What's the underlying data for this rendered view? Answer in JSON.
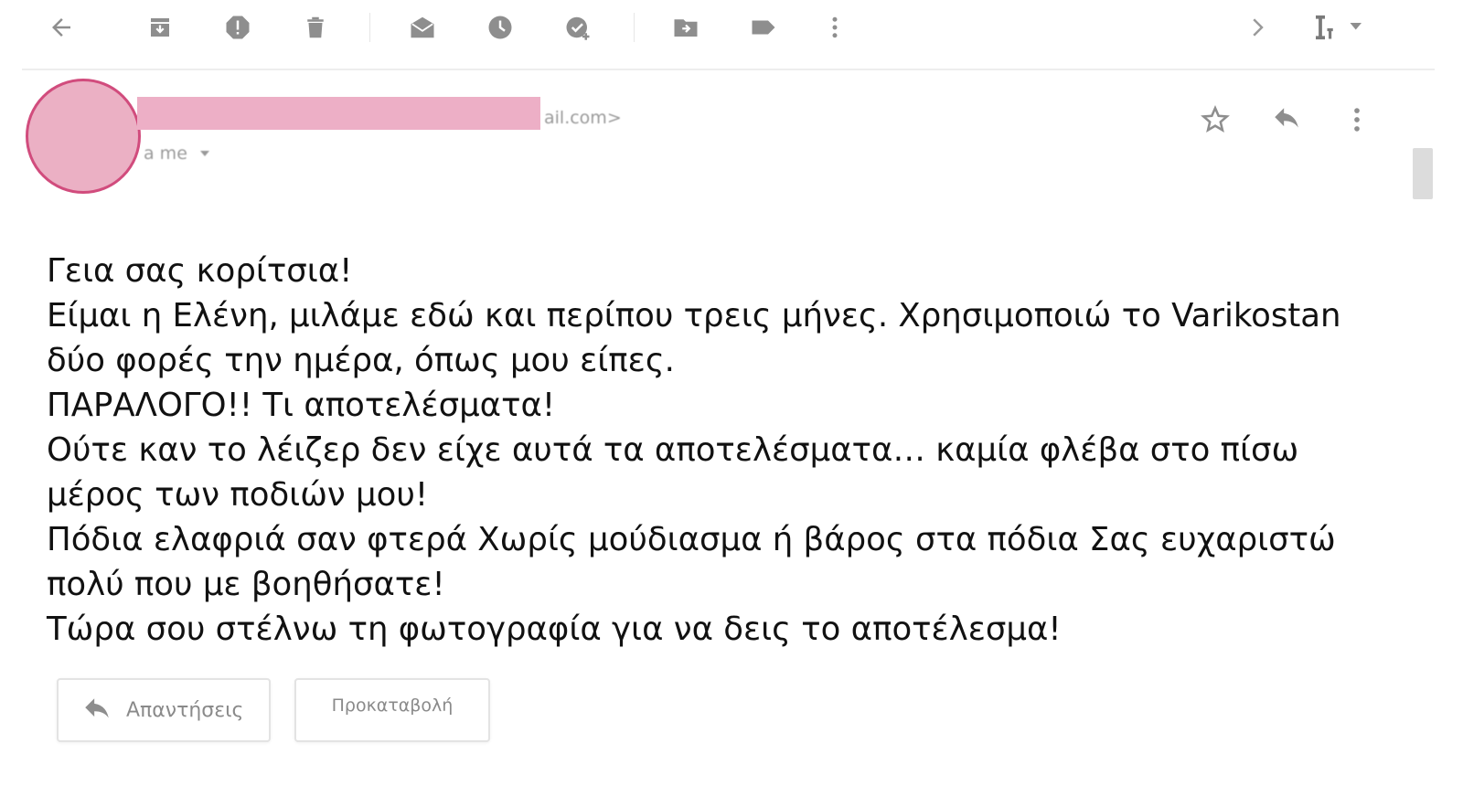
{
  "toolbar": {
    "icons": [
      "back-arrow-icon",
      "archive-icon",
      "report-spam-icon",
      "delete-icon",
      "mark-unread-icon",
      "snooze-icon",
      "add-to-tasks-icon",
      "move-to-icon",
      "labels-icon",
      "more-vert-icon",
      "next-icon",
      "input-tools-icon"
    ]
  },
  "header": {
    "sender_suffix": "ail.com>",
    "recipient": "a me"
  },
  "message": {
    "lines": [
      "Γεια σας κορίτσια!",
      "Είμαι η Ελένη, μιλάμε εδώ και περίπου τρεις μήνες. Χρησιμοποιώ το Varikostan δύο φορές την ημέρα, όπως μου είπες.",
      "ΠΑΡΑΛΟΓΟ!! Τι αποτελέσματα!",
      "Ούτε καν το λέιζερ δεν είχε αυτά τα αποτελέσματα… καμία φλέβα στο πίσω μέρος των ποδιών μου!",
      "Πόδια ελαφριά σαν φτερά Χωρίς μούδιασμα ή βάρος στα πόδια Σας ευχαριστώ πολύ που με βοηθήσατε!",
      "Τώρα σου στέλνω τη φωτογραφία για να δεις το αποτέλεσμα!"
    ]
  },
  "actions": {
    "reply_label": "Απαντήσεις",
    "forward_label": "Προκαταβολή"
  },
  "colors": {
    "avatar_fill": "#ebb0c4",
    "avatar_border": "#d14c7d",
    "redaction": "#edafc6",
    "icon_gray": "#8e8e8e"
  }
}
